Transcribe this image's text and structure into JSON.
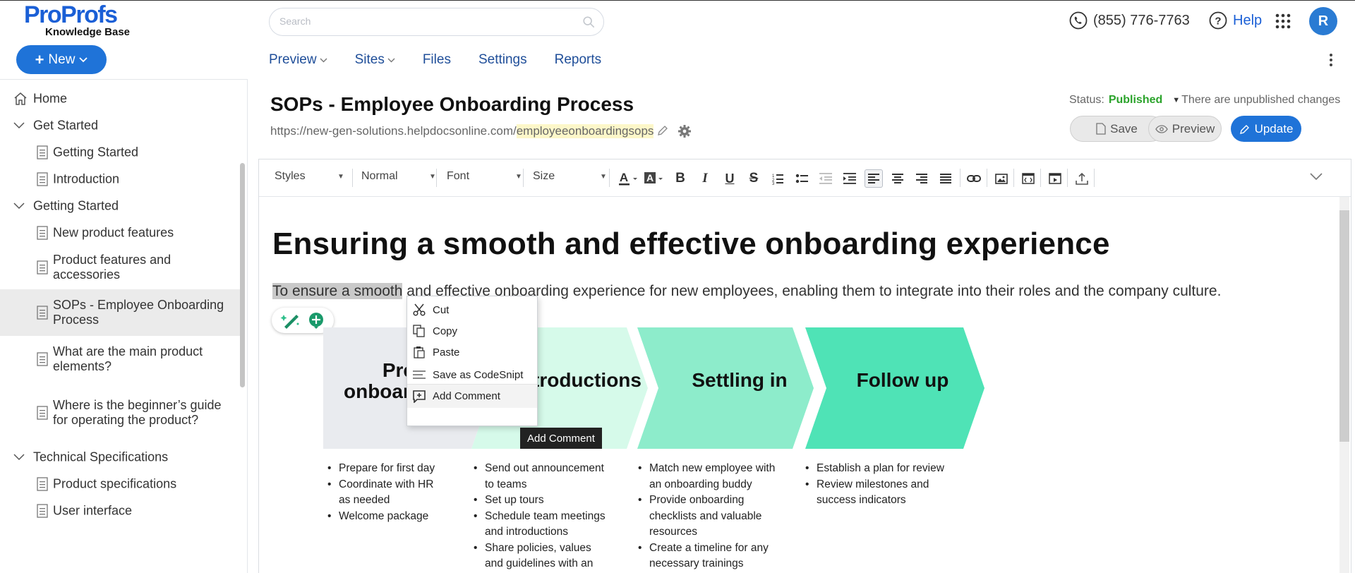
{
  "brand": {
    "logo_text": "ProProfs",
    "logo_sub": "Knowledge Base"
  },
  "header": {
    "search_placeholder": "Search",
    "phone": "(855) 776-7763",
    "help": "Help",
    "avatar_initial": "R"
  },
  "nav": {
    "new_label": "New",
    "items": [
      {
        "label": "Preview",
        "has_caret": true
      },
      {
        "label": "Sites",
        "has_caret": true
      },
      {
        "label": "Files",
        "has_caret": false
      },
      {
        "label": "Settings",
        "has_caret": false
      },
      {
        "label": "Reports",
        "has_caret": false
      }
    ]
  },
  "sidebar": {
    "items": [
      {
        "label": "Home",
        "type": "home"
      },
      {
        "label": "Get Started",
        "type": "category"
      },
      {
        "label": "Getting Started",
        "type": "page"
      },
      {
        "label": "Introduction",
        "type": "page"
      },
      {
        "label": "Getting Started",
        "type": "category"
      },
      {
        "label": "New product features",
        "type": "page"
      },
      {
        "label": "Product features and accessories",
        "type": "page"
      },
      {
        "label": "SOPs - Employee Onboarding Process",
        "type": "page",
        "active": true
      },
      {
        "label": "What are the main product elements?",
        "type": "page"
      },
      {
        "label": "Where is the beginner’s guide for operating the product?",
        "type": "page"
      },
      {
        "label": "Technical Specifications",
        "type": "category"
      },
      {
        "label": "Product specifications",
        "type": "page"
      },
      {
        "label": "User interface",
        "type": "page"
      }
    ]
  },
  "article": {
    "title": "SOPs - Employee Onboarding Process",
    "url_base": "https://new-gen-solutions.helpdocsonline.com/",
    "url_slug": "employeeonboardingsops",
    "status_label": "Status:",
    "status_value": "Published",
    "unpublished_note": "There are unpublished changes",
    "save_label": "Save",
    "preview_label": "Preview",
    "update_label": "Update"
  },
  "toolbar": {
    "styles": "Styles",
    "format": "Normal",
    "font": "Font",
    "size": "Size"
  },
  "content": {
    "heading": "Ensuring a smooth and effective onboarding experience",
    "para_selected": "To ensure a smooth",
    "para_rest": " and effective onboarding experience for new employees, enabling them to integrate into their roles and the company culture.",
    "steps": [
      {
        "label_l1": "Pre",
        "label_l2": "onboar",
        "color": "#e9ebef",
        "bullets": [
          "Prepare for first day",
          "Coordinate with HR as needed",
          "Welcome package"
        ]
      },
      {
        "label_l1": "troductions",
        "label_l2": "",
        "color": "#d6faea",
        "bullets": [
          "Send out announcement to teams",
          "Set up tours",
          "Schedule team meetings and introductions",
          "Share policies, values and guidelines with an"
        ]
      },
      {
        "label_l1": "Settling in",
        "label_l2": "",
        "color": "#8deccb",
        "bullets": [
          "Match new employee with an onboarding buddy",
          "Provide onboarding checklists and valuable resources",
          "Create a timeline for any necessary trainings"
        ]
      },
      {
        "label_l1": "Follow up",
        "label_l2": "",
        "color": "#4fe3b6",
        "bullets": [
          "Establish a plan for review",
          "Review milestones and success indicators"
        ]
      }
    ]
  },
  "context_menu": {
    "items": [
      "Cut",
      "Copy",
      "Paste",
      "Save as CodeSnipt",
      "Add Comment"
    ],
    "tooltip": "Add Comment"
  }
}
